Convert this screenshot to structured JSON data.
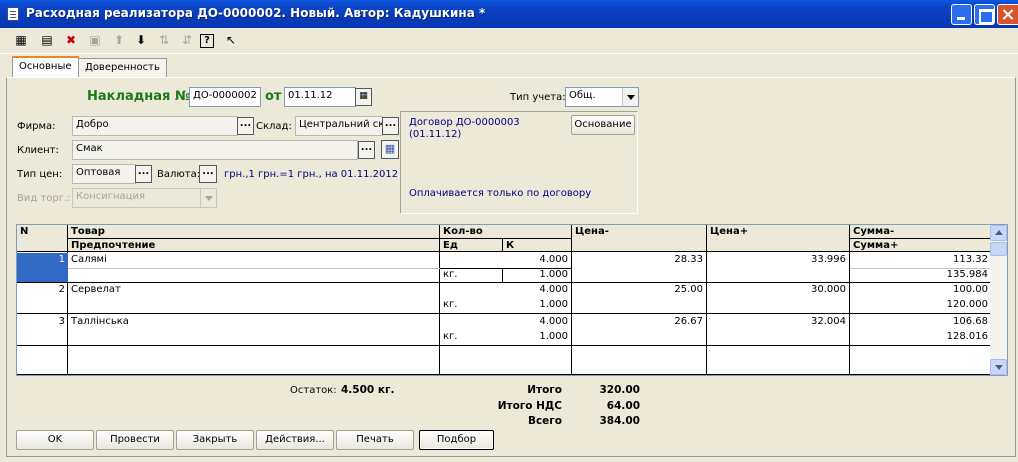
{
  "window": {
    "title": "Расходная реализатора  ДО-0000002. Новый. Автор: Кадушкина *"
  },
  "toolbar": {
    "icons": [
      "new-row-icon",
      "insert-row-icon",
      "delete-row-icon",
      "copy-row-icon",
      "move-up-icon",
      "move-down-icon",
      "sort-asc-icon",
      "sort-desc-icon",
      "help-icon",
      "context-help-icon"
    ]
  },
  "tabs": [
    {
      "label": "Основные",
      "active": true
    },
    {
      "label": "Доверенность",
      "active": false
    }
  ],
  "header": {
    "invoice_label": "Накладная №",
    "invoice_number": "ДО-0000002",
    "date_label": "от",
    "date_value": "01.11.12",
    "account_type_label": "Тип учета:",
    "account_type_value": "Общ."
  },
  "form": {
    "firm_label": "Фирма:",
    "firm_value": "Добро",
    "warehouse_label": "Склад:",
    "warehouse_value": "Центральний ск",
    "client_label": "Клиент:",
    "client_value": "Смак",
    "price_type_label": "Тип цен:",
    "price_type_value": "Оптовая",
    "currency_label": "Валюта:",
    "currency_info": "грн.,1 грн.=1 грн., на 01.11.2012",
    "trade_type_label": "Вид торг.:",
    "trade_type_value": "Консигнация",
    "select_button": "..."
  },
  "contract": {
    "text_line1": "Договор ДО-0000003",
    "text_line2": "(01.11.12)",
    "basis_button": "Основание",
    "note": "Оплачивается только по договору"
  },
  "table": {
    "headers": {
      "n": "N",
      "product": "Товар",
      "preference": "Предпочтение",
      "qty": "Кол-во",
      "unit": "Ед",
      "k": "К",
      "price_minus": "Цена-",
      "price_plus": "Цена+",
      "sum_minus": "Сумма-",
      "sum_plus": "Сумма+"
    },
    "rows": [
      {
        "n": "1",
        "product": "Салямі",
        "preference": "",
        "qty": "4.000",
        "unit": "кг.",
        "k": "1.000",
        "price_minus": "28.33",
        "price_plus": "33.996",
        "sum_minus": "113.32",
        "sum_plus": "135.984"
      },
      {
        "n": "2",
        "product": "Сервелат",
        "preference": "",
        "qty": "4.000",
        "unit": "кг.",
        "k": "1.000",
        "price_minus": "25.00",
        "price_plus": "30.000",
        "sum_minus": "100.00",
        "sum_plus": "120.000"
      },
      {
        "n": "3",
        "product": "Таллінська",
        "preference": "",
        "qty": "4.000",
        "unit": "кг.",
        "k": "1.000",
        "price_minus": "26.67",
        "price_plus": "32.004",
        "sum_minus": "106.68",
        "sum_plus": "128.016"
      }
    ]
  },
  "summary": {
    "remainder_label": "Остаток:",
    "remainder_value": "4.500 кг.",
    "total_label": "Итого",
    "total_value": "320.00",
    "vat_label": "Итого НДС",
    "vat_value": "64.00",
    "grand_label": "Всего",
    "grand_value": "384.00"
  },
  "buttons": {
    "ok": "OK",
    "post": "Провести",
    "close": "Закрыть",
    "actions": "Действия...",
    "print": "Печать",
    "selection": "Подбор"
  },
  "colors": {
    "title_bar": "#0a3fbf",
    "invoice_label": "#1a7a1a",
    "link_text": "#000080",
    "selected_cell": "#316ac5"
  }
}
